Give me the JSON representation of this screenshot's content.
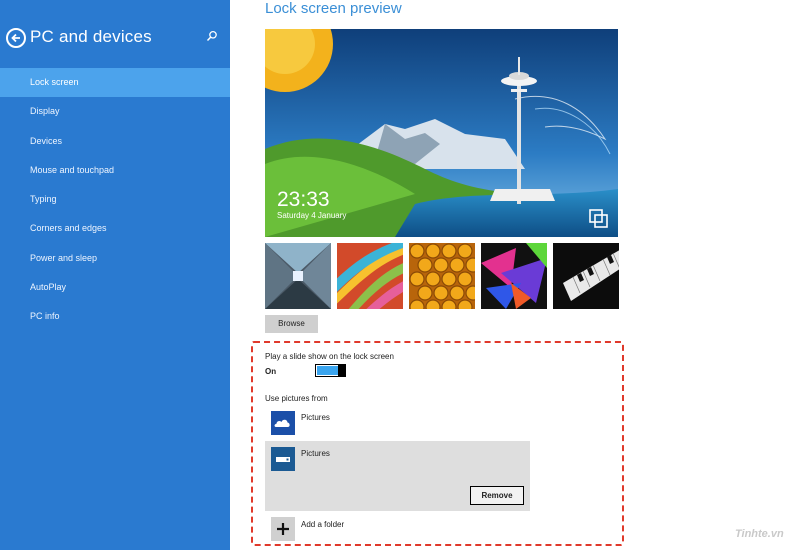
{
  "sidebar": {
    "title": "PC and devices",
    "items": [
      {
        "label": "Lock screen",
        "active": true
      },
      {
        "label": "Display"
      },
      {
        "label": "Devices"
      },
      {
        "label": "Mouse and touchpad"
      },
      {
        "label": "Typing"
      },
      {
        "label": "Corners and edges"
      },
      {
        "label": "Power and sleep"
      },
      {
        "label": "AutoPlay"
      },
      {
        "label": "PC info"
      }
    ],
    "bg_color": "#2a7ad0",
    "active_color": "#4ca3ec"
  },
  "main": {
    "section_title": "Lock screen preview",
    "preview": {
      "time": "23:33",
      "date": "Saturday 4 January"
    },
    "thumbnails": [
      "tunnel",
      "color-ribbons",
      "honeycomb",
      "color-shapes",
      "piano-keys"
    ],
    "browse_label": "Browse",
    "slideshow": {
      "label": "Play a slide show on the lock screen",
      "state": "On",
      "on": true
    },
    "use_pictures_label": "Use pictures from",
    "sources": [
      {
        "name": "Pictures",
        "icon": "onedrive-icon"
      },
      {
        "name": "Pictures",
        "icon": "drive-icon",
        "selected": true
      }
    ],
    "remove_label": "Remove",
    "add_folder_label": "Add a folder",
    "accent_color": "#3b8fd6",
    "highlight_color": "#e0392b"
  },
  "watermark": "Tinhte.vn"
}
